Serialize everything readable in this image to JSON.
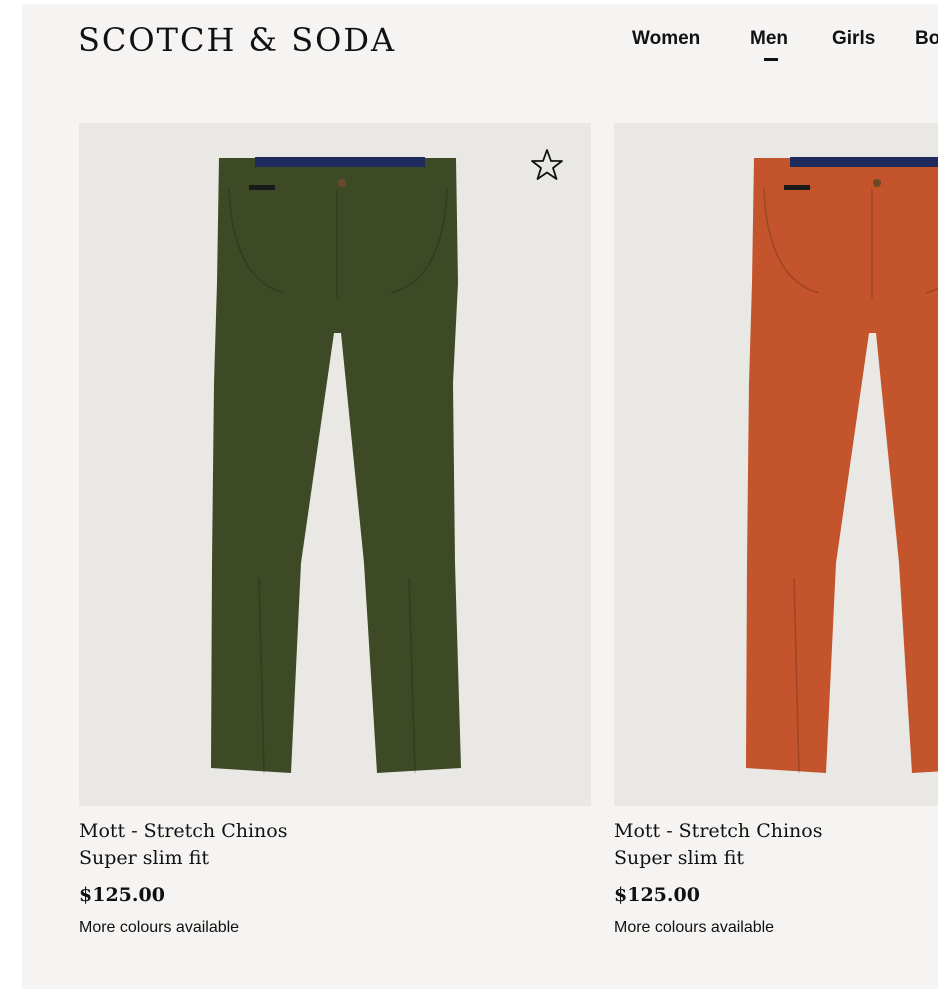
{
  "header": {
    "logo": "SCOTCH & SODA",
    "nav": [
      {
        "label": "Women"
      },
      {
        "label": "Men",
        "active": true
      },
      {
        "label": "Girls"
      },
      {
        "label": "Bo"
      }
    ]
  },
  "products": [
    {
      "name": "Mott - Stretch Chinos",
      "fit": "Super slim fit",
      "price": "$125.00",
      "note": "More colours available",
      "color": "#3e4a25",
      "wishlist_icon": "star-outline-icon"
    },
    {
      "name": "Mott - Stretch Chinos",
      "fit": "Super slim fit",
      "price": "$125.00",
      "note": "More colours available",
      "color": "#c4542b"
    }
  ],
  "colors": {
    "page_background": "#f6f4f2",
    "image_background": "#e9e8e4",
    "waistband_lining": "#1f2a5c"
  }
}
